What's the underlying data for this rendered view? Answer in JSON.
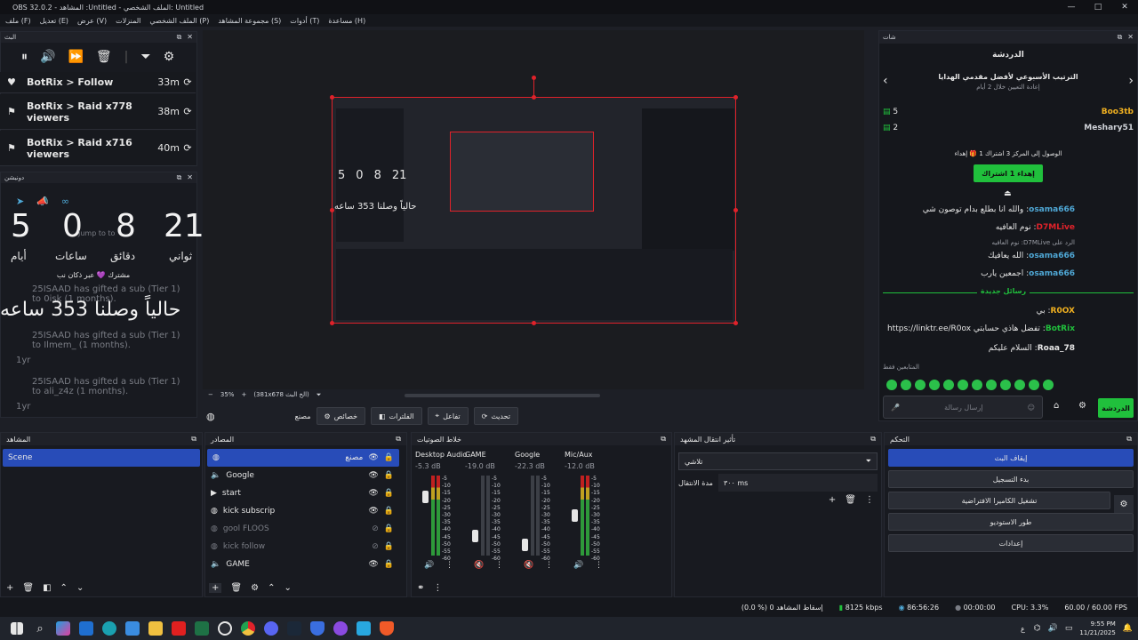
{
  "window": {
    "title": "OBS 32.0.2 - المشاهد :Untitled - الملف الشخصي: Untitled",
    "controls": [
      "—",
      "□",
      "✕"
    ]
  },
  "menu": [
    "ملف (F)",
    "تعديل (E)",
    "عرض (V)",
    "المنزلات",
    "الملف الشخصي (P)",
    "مجموعة المشاهد (S)",
    "أدوات (T)",
    "مساعدة (H)"
  ],
  "alerts": {
    "title": "البث",
    "events": [
      {
        "name": "BotRix > Follow",
        "time": "33m"
      },
      {
        "name": "BotRix > Raid x778 viewers",
        "time": "38m"
      },
      {
        "name": "BotRix > Raid x716 viewers",
        "time": "40m"
      }
    ]
  },
  "countdown": {
    "title": "دونيشن",
    "days": "5",
    "hours": "0",
    "minutes": "8",
    "seconds": "21",
    "days_label": "أيام",
    "hours_label": "ساعات",
    "minutes_label": "دقائق",
    "seconds_label": "ثواني",
    "jump": "Jump to to",
    "caption": "حالياً وصلنا 353 ساعه",
    "sub_label": "مشترك 💜 عبر ذكان نب",
    "gifts": [
      {
        "text": "25ISAAD has gifted a sub (Tier 1) to Ilmem_ (1 months).",
        "age": "1yr"
      },
      {
        "text": "25ISAAD has gifted a sub (Tier 1) to ali_z4z (1 months).",
        "age": "1yr"
      },
      {
        "text": "25ISAAD has gifted a sub (Tier 1) to 0isk (1 months).",
        "age": "1yr"
      }
    ]
  },
  "preview": {
    "zoom": "35%",
    "resolution": "(381x678 الخ البث)",
    "preview_overlay": "حالياً وصلنا 353 ساعه",
    "mini_digits": [
      "5",
      "0",
      "8",
      "21"
    ]
  },
  "source_toolbar": {
    "selected": "مصنع",
    "buttons": [
      "خصائص",
      "الفلترات",
      "تفاعل",
      "تحديث"
    ]
  },
  "scenes": {
    "title": "المشاهد",
    "items": [
      "Scene"
    ]
  },
  "sources": {
    "title": "المصادر",
    "items": [
      {
        "name": "مصنع",
        "icon": "browser-icon",
        "visible": true
      },
      {
        "name": "Google",
        "icon": "audio-icon",
        "visible": true
      },
      {
        "name": "start",
        "icon": "media-icon",
        "visible": true
      },
      {
        "name": "kick subscrip",
        "icon": "browser-icon",
        "visible": true
      },
      {
        "name": "gool FLOOS",
        "icon": "browser-icon",
        "visible": false
      },
      {
        "name": "kick follow",
        "icon": "browser-icon",
        "visible": false
      },
      {
        "name": "GAME",
        "icon": "audio-icon",
        "visible": true
      }
    ]
  },
  "mixer": {
    "title": "خلاط الصوتيات",
    "channels": [
      {
        "name": "Desktop Audio",
        "db": "-5.3 dB",
        "muted": false
      },
      {
        "name": "GAME",
        "db": "-19.0 dB",
        "muted": true
      },
      {
        "name": "Google",
        "db": "-22.3 dB",
        "muted": true
      },
      {
        "name": "Mic/Aux",
        "db": "-12.0 dB",
        "muted": false
      }
    ],
    "scale": [
      "-5",
      "-10",
      "-15",
      "-20",
      "-25",
      "-30",
      "-35",
      "-40",
      "-45",
      "-50",
      "-55",
      "-60"
    ]
  },
  "transitions": {
    "title": "تأثير انتقال المشهد",
    "type": "تلاشي",
    "duration_label": "مدة الانتقال",
    "duration": "٣٠٠ ms"
  },
  "controls": {
    "title": "التحكم",
    "buttons": [
      "إيقاف البث",
      "بدء التسجيل",
      "تشغيل الكاميرا الافتراضية",
      "طور الاستوديو",
      "إعدادات"
    ]
  },
  "chat": {
    "title": "شات",
    "header": "الدردشة",
    "leaderboard_title": "الترتيب الأسبوعي لأفضل مقدمي الهدايا",
    "leaderboard_sub": "إعادة التعيين خلال 2 أيام",
    "leaders": [
      {
        "name": "Boo3tb",
        "count": "5"
      },
      {
        "name": "Meshary51",
        "count": "2"
      }
    ],
    "gift_notice": "الوصول إلى المركز 3 اشتراك 1 🎁 إهداء",
    "gift_button": "إهداء 1 اشتراك",
    "messages": [
      {
        "user": "osama666",
        "text": "والله انا بطلع بدام توصون شي"
      },
      {
        "user": "D7MLive",
        "text": "نوم العافيه"
      },
      {
        "user": "",
        "text": "الرد على D7MLive: نوم العافيه"
      },
      {
        "user": "osama666",
        "text": "الله يعافيك"
      },
      {
        "user": "osama666",
        "text": "اجمعين يارب"
      }
    ],
    "new_messages": "رسائل جديدة",
    "new": [
      {
        "user": "R0OX",
        "text": "بي"
      },
      {
        "user": "BotRix",
        "text": "تفضل هاذي حسابتي https://linktr.ee/R0ox"
      },
      {
        "user": "Roaa_78",
        "text": "السلام عليكم"
      }
    ],
    "emotes_label": "المتابعين فقط",
    "input_placeholder": "إرسال رسالة",
    "send_label": "الدردشة"
  },
  "status": {
    "dropped": "(0.0 %) إسقاط المشاهد 0",
    "bitrate": "8125 kbps",
    "stream_time": "86:56:26",
    "rec_time": "00:00:00",
    "cpu": "CPU: 3.3%",
    "fps": "60.00 / 60.00 FPS"
  },
  "taskbar": {
    "time": "9:55 PM",
    "date": "11/21/2025",
    "lang": "ع"
  },
  "colors": {
    "accent": "#284cb8",
    "stream_red": "#e0222a",
    "kick_green": "#20c03c"
  }
}
